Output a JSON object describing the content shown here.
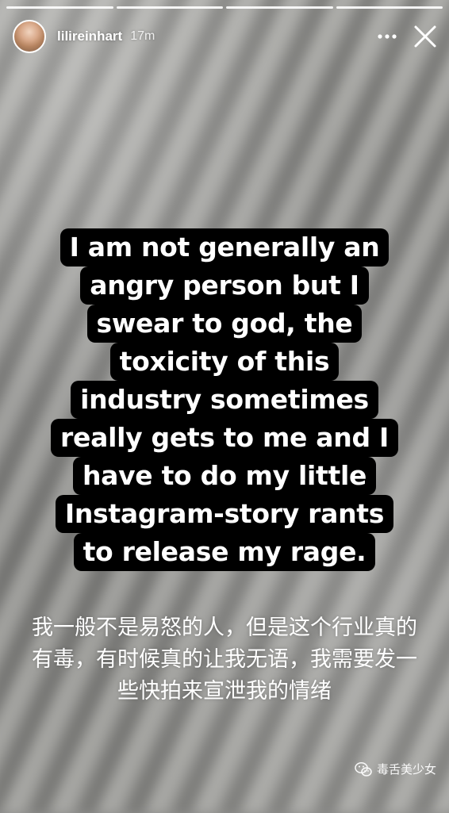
{
  "story": {
    "segments": 4,
    "username": "lilireinhart",
    "time": "17m"
  },
  "caption_lines": [
    "I am not generally an",
    "angry person but I",
    "swear to god, the",
    "toxicity of this",
    "industry sometimes",
    "really gets to me and I",
    "have to do my little",
    "Instagram-story rants",
    "to release my rage."
  ],
  "translation": "我一般不是易怒的人，但是这个行业真的有毒，有时候真的让我无语，我需要发一些快拍来宣泄我的情绪",
  "watermark": "毒舌美少女",
  "icons": {
    "more": "more-icon",
    "close": "close-icon",
    "watermark": "wechat-icon"
  }
}
